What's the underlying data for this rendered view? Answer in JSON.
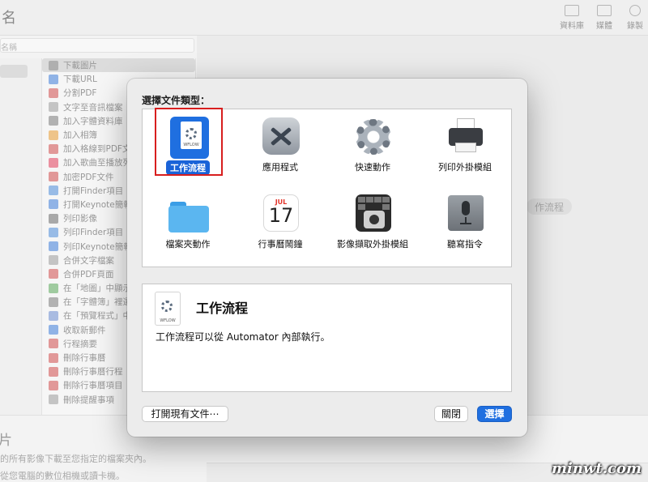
{
  "background_window": {
    "title": "名",
    "toolbar": [
      {
        "label": "資料庫",
        "icon": "library-icon"
      },
      {
        "label": "媒體",
        "icon": "media-icon"
      },
      {
        "label": "錄製",
        "icon": "record-icon"
      }
    ],
    "search_placeholder": "名稱",
    "actions": [
      {
        "label": "下載圖片",
        "color": "#8a8a8a",
        "selected": true
      },
      {
        "label": "下載URL",
        "color": "#3d7bd8"
      },
      {
        "label": "分割PDF",
        "color": "#d04a4a"
      },
      {
        "label": "文字至音訊檔案",
        "color": "#9a9a9a"
      },
      {
        "label": "加入字體資料庫",
        "color": "#7a7a7a"
      },
      {
        "label": "加入相簿",
        "color": "#e89a30"
      },
      {
        "label": "加入格線到PDF文",
        "color": "#d04a4a"
      },
      {
        "label": "加入歌曲至播放列",
        "color": "#e23c5a"
      },
      {
        "label": "加密PDF文件",
        "color": "#d04a4a"
      },
      {
        "label": "打開Finder項目",
        "color": "#4a8ad8"
      },
      {
        "label": "打開Keynote簡報",
        "color": "#3d7bd8"
      },
      {
        "label": "列印影像",
        "color": "#6a6a6a"
      },
      {
        "label": "列印Finder項目",
        "color": "#4a8ad8"
      },
      {
        "label": "列印Keynote簡報",
        "color": "#3d7bd8"
      },
      {
        "label": "合併文字檔案",
        "color": "#9a9a9a"
      },
      {
        "label": "合併PDF頁面",
        "color": "#d04a4a"
      },
      {
        "label": "在「地圖」中顯示",
        "color": "#5aa85a"
      },
      {
        "label": "在「字體簿」裡選",
        "color": "#7a7a7a"
      },
      {
        "label": "在「預覽程式」中",
        "color": "#6a8ad0"
      },
      {
        "label": "收取新郵件",
        "color": "#3d7bd8"
      },
      {
        "label": "行程摘要",
        "color": "#d04a4a"
      },
      {
        "label": "刪除行事曆",
        "color": "#d04a4a"
      },
      {
        "label": "刪除行事曆行程",
        "color": "#d04a4a"
      },
      {
        "label": "刪除行事曆項目",
        "color": "#d04a4a"
      },
      {
        "label": "刪除提醒事項",
        "color": "#9a9a9a"
      }
    ],
    "workspace_hint": "作流程",
    "bottom_title": "片",
    "bottom_line1": "的所有影像下載至您指定的檔案夾內。",
    "bottom_line2": "從您電腦的數位相機或讀卡機。"
  },
  "dialog": {
    "prompt": "選擇文件類型：",
    "types": [
      {
        "label": "工作流程",
        "icon": "workflow-icon",
        "selected": true,
        "caption": "WFLOW"
      },
      {
        "label": "應用程式",
        "icon": "application-icon"
      },
      {
        "label": "快速動作",
        "icon": "gear-icon"
      },
      {
        "label": "列印外掛模組",
        "icon": "printer-icon"
      },
      {
        "label": "檔案夾動作",
        "icon": "folder-icon"
      },
      {
        "label": "行事曆鬧鐘",
        "icon": "calendar-icon",
        "month": "JUL",
        "day": "17"
      },
      {
        "label": "影像擷取外掛模組",
        "icon": "image-capture-icon"
      },
      {
        "label": "聽寫指令",
        "icon": "microphone-icon"
      }
    ],
    "description": {
      "title": "工作流程",
      "text": "工作流程可以從 Automator 內部執行。",
      "caption": "WFLOW"
    },
    "buttons": {
      "open_existing": "打開現有文件⋯",
      "close": "關閉",
      "choose": "選擇"
    }
  },
  "watermark": "minwt.com",
  "colors": {
    "accent": "#1f6fe0",
    "highlight_box": "#d81e1e"
  }
}
